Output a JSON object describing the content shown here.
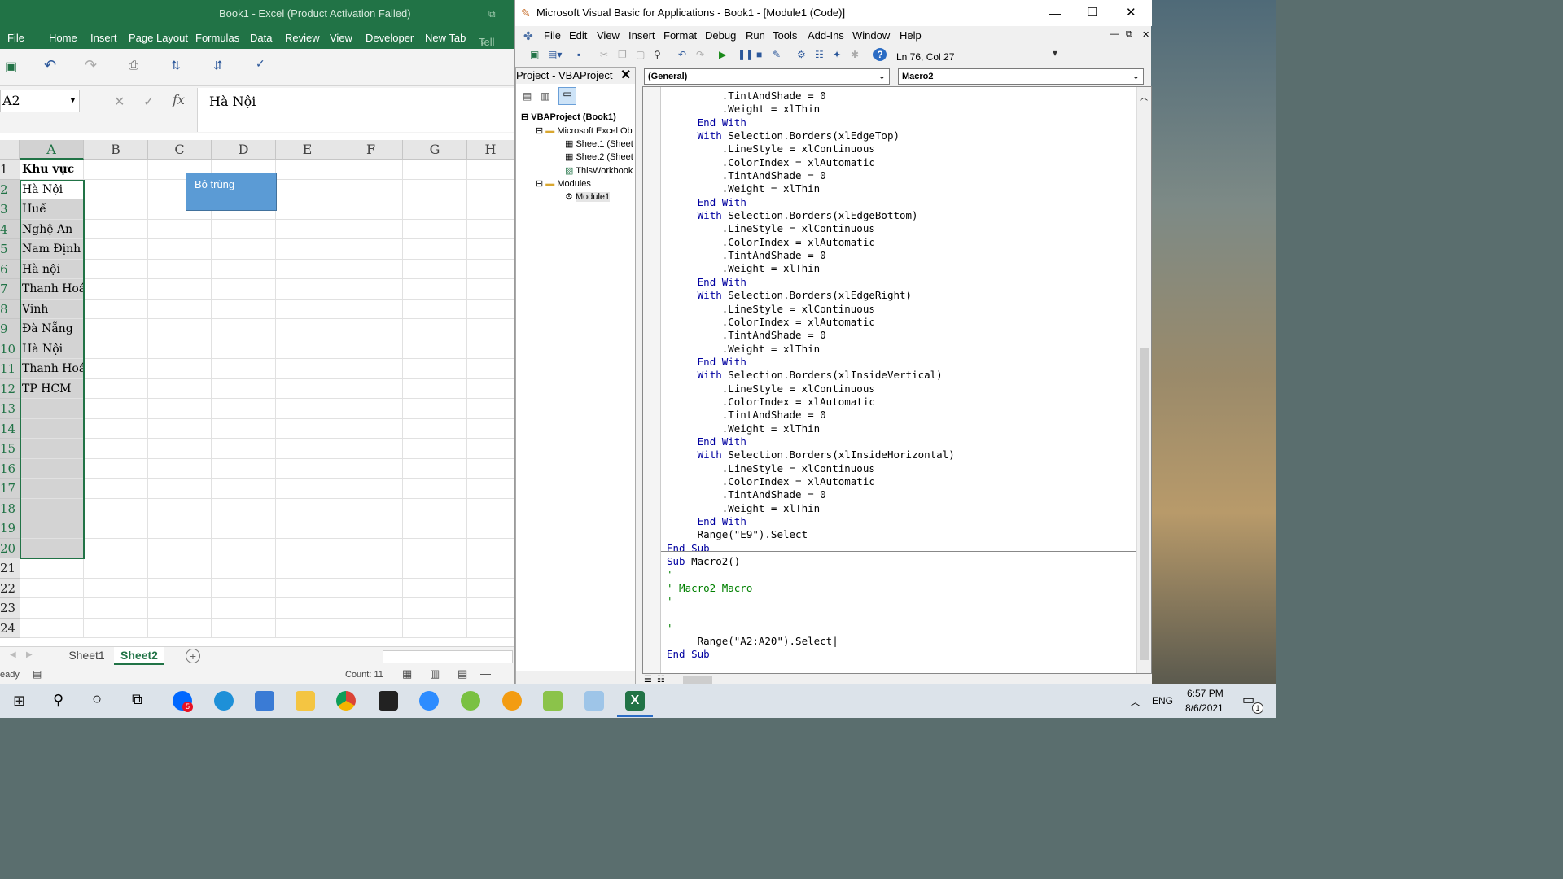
{
  "excel": {
    "title": "Book1 - Excel (Product Activation Failed)",
    "tabs": [
      "File",
      "Home",
      "Insert",
      "Page Layout",
      "Formulas",
      "Data",
      "Review",
      "View",
      "Developer",
      "New Tab",
      "Tell m"
    ],
    "name_box": "A2",
    "formula_value": "Hà Nội",
    "columns": [
      "A",
      "B",
      "C",
      "D",
      "E",
      "F",
      "G",
      "H"
    ],
    "rows": [
      "1",
      "2",
      "3",
      "4",
      "5",
      "6",
      "7",
      "8",
      "9",
      "10",
      "11",
      "12",
      "13",
      "14",
      "15",
      "16",
      "17",
      "18",
      "19",
      "20",
      "21",
      "22",
      "23",
      "24"
    ],
    "col_a": [
      "Khu vực",
      "Hà Nội",
      "Huế",
      "Nghệ An",
      "Nam Định",
      "Hà  nội",
      "Thanh Hoá",
      "Vinh",
      "Đà Nẵng",
      "Hà Nội",
      "Thanh Hoá",
      "TP HCM"
    ],
    "button_label": "Bỏ trùng",
    "sheets": [
      "Sheet1",
      "Sheet2"
    ],
    "status_left": "eady",
    "status_count": "Count: 11"
  },
  "vba": {
    "title": "Microsoft Visual Basic for Applications - Book1 - [Module1 (Code)]",
    "menu": [
      "File",
      "Edit",
      "View",
      "Insert",
      "Format",
      "Debug",
      "Run",
      "Tools",
      "Add-Ins",
      "Window",
      "Help"
    ],
    "position": "Ln 76, Col 27",
    "project_title": "Project - VBAProject",
    "tree": [
      "VBAProject (Book1)",
      "Microsoft Excel Ob",
      "Sheet1 (Sheet",
      "Sheet2 (Sheet",
      "ThisWorkbook",
      "Modules",
      "Module1"
    ],
    "combo_left": "(General)",
    "combo_right": "Macro2"
  },
  "taskbar": {
    "lang": "ENG",
    "time": "6:57 PM",
    "date": "8/6/2021",
    "notif_count": "1",
    "zalo_badge": "5"
  },
  "colors": {
    "excel_green": "#217346",
    "selection_gray": "#d3d3d3",
    "button_blue": "#5b9bd5",
    "keyword": "#0000a0",
    "comment": "#008000"
  }
}
